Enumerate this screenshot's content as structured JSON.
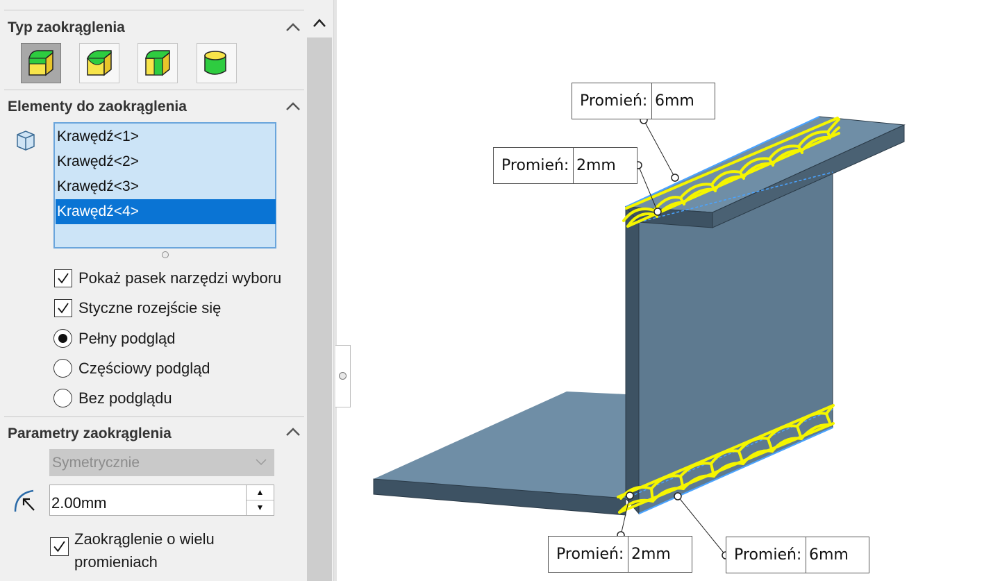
{
  "fillet_type": {
    "title": "Typ zaokrąglenia",
    "options": [
      {
        "icon": "constant-size-fillet-icon",
        "active": true
      },
      {
        "icon": "variable-size-fillet-icon",
        "active": false
      },
      {
        "icon": "face-fillet-icon",
        "active": false
      },
      {
        "icon": "full-round-fillet-icon",
        "active": false
      }
    ]
  },
  "items_to_fillet": {
    "title": "Elementy do zaokrąglenia",
    "edges": [
      "Krawędź<1>",
      "Krawędź<2>",
      "Krawędź<3>",
      "Krawędź<4>"
    ],
    "selected_index": 3,
    "options": [
      {
        "type": "checkbox",
        "label": "Pokaż pasek narzędzi wyboru",
        "checked": true
      },
      {
        "type": "checkbox",
        "label": "Styczne rozejście się",
        "checked": true
      },
      {
        "type": "radio",
        "label": "Pełny podgląd",
        "checked": true
      },
      {
        "type": "radio",
        "label": "Częściowy podgląd",
        "checked": false
      },
      {
        "type": "radio",
        "label": "Bez podglądu",
        "checked": false
      }
    ]
  },
  "fillet_params": {
    "title": "Parametry zaokrąglenia",
    "profile_select": "Symetrycznie",
    "radius_value": "2.00mm",
    "multi_radius_label": "Zaokrąglenie o wielu promieniach",
    "multi_radius_checked": true
  },
  "callouts": [
    {
      "label": "Promień:",
      "value": "6mm"
    },
    {
      "label": "Promień:",
      "value": "2mm"
    },
    {
      "label": "Promień:",
      "value": "2mm"
    },
    {
      "label": "Promień:",
      "value": "6mm"
    }
  ],
  "colors": {
    "model_top": "#6a8aa2",
    "model_front": "#5e7a90",
    "model_side": "#3d5263",
    "highlight": "#f5f500",
    "selection_edge": "#4aa3ff",
    "list_bg": "#cce4f7",
    "list_selected": "#0a74d4"
  }
}
